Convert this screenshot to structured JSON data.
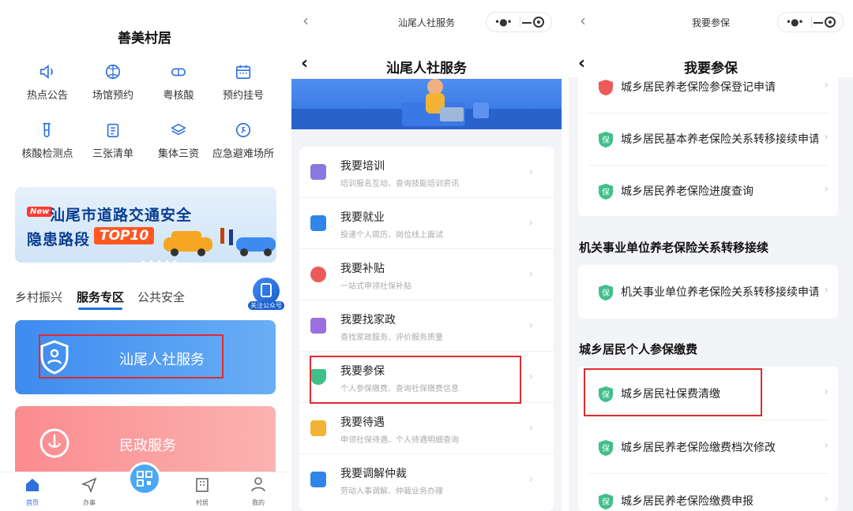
{
  "panel1": {
    "title": "善美村居",
    "grid": [
      {
        "label": "热点公告",
        "icon": "speaker-icon"
      },
      {
        "label": "场馆预约",
        "icon": "ball-icon"
      },
      {
        "label": "粤核酸",
        "icon": "capsule-icon"
      },
      {
        "label": "预约挂号",
        "icon": "calendar-icon"
      },
      {
        "label": "核酸检测点",
        "icon": "test-tube-icon"
      },
      {
        "label": "三张清单",
        "icon": "clipboard-icon"
      },
      {
        "label": "集体三资",
        "icon": "layers-icon"
      },
      {
        "label": "应急避难场所",
        "icon": "runner-icon"
      }
    ],
    "banner": {
      "new_badge": "New",
      "line1": "汕尾市道路交通安全",
      "line2": "隐患路段",
      "top_badge": "TOP10"
    },
    "tabs": [
      "乡村振兴",
      "服务专区",
      "公共安全"
    ],
    "active_tab": "服务专区",
    "fab_label": "关注公众号",
    "services": [
      {
        "label": "汕尾人社服务",
        "color": "#3d8bef"
      },
      {
        "label": "民政服务",
        "color": "#fb8b8f"
      }
    ],
    "bottom_nav": [
      "首页",
      "办事",
      "村居",
      "我的"
    ]
  },
  "panel2": {
    "mini_title": "汕尾人社服务",
    "page_title": "汕尾人社服务",
    "rows": [
      {
        "title": "我要培训",
        "sub": "培训报名互动、查询技能培训资讯",
        "color": "#8a78e0"
      },
      {
        "title": "我要就业",
        "sub": "投递个人简历、岗位线上面试",
        "color": "#2f86e8"
      },
      {
        "title": "我要补贴",
        "sub": "一站式申领社保补贴",
        "color": "#ec5a5a"
      },
      {
        "title": "我要找家政",
        "sub": "查找家政服务、评价服务质量",
        "color": "#9a6fe0"
      },
      {
        "title": "我要参保",
        "sub": "个人参保缴费、查询社保缴费信息",
        "color": "#3fbf8a"
      },
      {
        "title": "我要待遇",
        "sub": "申领社保待遇、个人待遇明细查询",
        "color": "#f2b233"
      },
      {
        "title": "我要调解仲裁",
        "sub": "劳动人事调解、仲裁业务办理",
        "color": "#2f86e8"
      }
    ]
  },
  "panel3": {
    "mini_title": "我要参保",
    "page_title": "我要参保",
    "card1": [
      "城乡居民养老保险参保登记申请",
      "城乡居民基本养老保险关系转移接续申请",
      "城乡居民养老保险进度查询"
    ],
    "section1": "机关事业单位养老保险关系转移接续",
    "card2": [
      "机关事业单位养老保险关系转移接续申请"
    ],
    "section2": "城乡居民个人参保缴费",
    "card3": [
      "城乡居民社保费清缴",
      "城乡居民养老保险缴费档次修改",
      "城乡居民养老保险缴费申报"
    ]
  },
  "colors": {
    "highlight": "#e02b2b",
    "accent": "#1f6fe0",
    "shield_green": "#3fbf8a"
  }
}
